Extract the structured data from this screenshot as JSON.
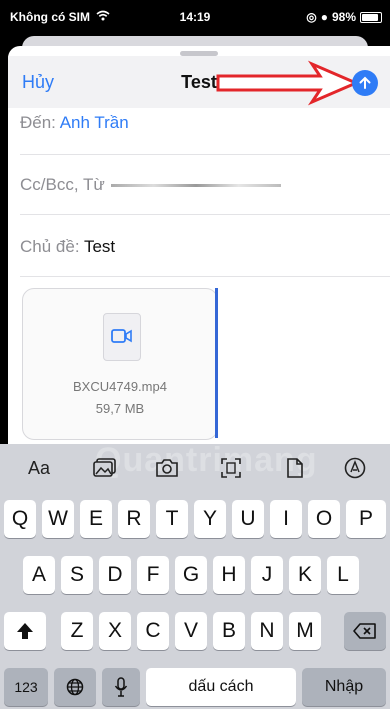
{
  "status": {
    "carrier": "Không có SIM",
    "time": "14:19",
    "battery": "98%"
  },
  "compose": {
    "cancel": "Hủy",
    "title": "Test",
    "to_label": "Đến:",
    "to_value": "Anh Trần",
    "cc_label": "Cc/Bcc, Từ",
    "subject_label": "Chủ đề:",
    "subject_value": "Test"
  },
  "attachment": {
    "name": "BXCU4749.mp4",
    "size": "59,7 MB"
  },
  "keyboard": {
    "toolbar": {
      "text_format": "Aa",
      "watermark": "Quantrimang"
    },
    "row1": [
      "Q",
      "W",
      "E",
      "R",
      "T",
      "Y",
      "U",
      "I",
      "O",
      "P"
    ],
    "row2": [
      "A",
      "S",
      "D",
      "F",
      "G",
      "H",
      "J",
      "K",
      "L"
    ],
    "row3": [
      "Z",
      "X",
      "C",
      "V",
      "B",
      "N",
      "M"
    ],
    "numbers": "123",
    "space": "dấu cách",
    "return": "Nhập"
  }
}
